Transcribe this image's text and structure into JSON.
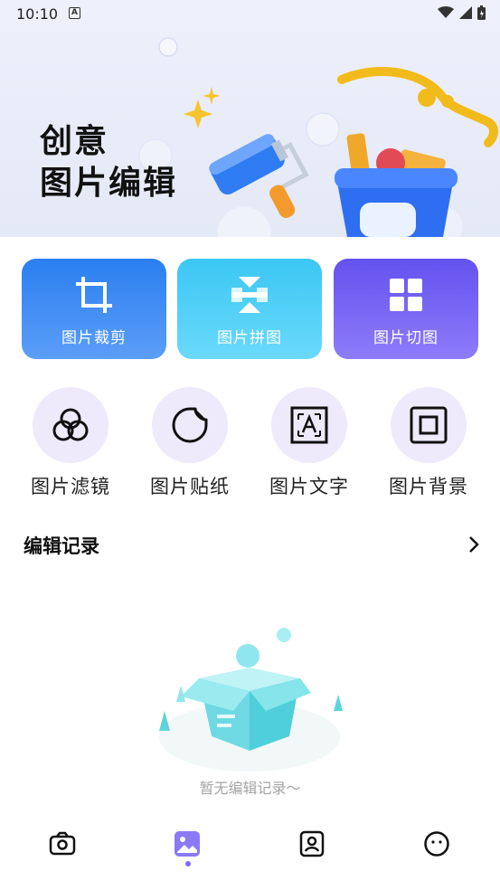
{
  "status_bar": {
    "time": "10:10",
    "notification_icon": "a-icon",
    "icons": [
      "wifi-icon",
      "cellular-icon",
      "battery-icon"
    ]
  },
  "hero": {
    "title_line1": "创意",
    "title_line2": "图片编辑"
  },
  "feature_tiles": [
    {
      "label": "图片裁剪",
      "icon": "crop-icon"
    },
    {
      "label": "图片拼图",
      "icon": "collage-icon"
    },
    {
      "label": "图片切图",
      "icon": "grid-icon"
    }
  ],
  "tools": [
    {
      "label": "图片滤镜",
      "icon": "filter-icon"
    },
    {
      "label": "图片贴纸",
      "icon": "sticker-icon"
    },
    {
      "label": "图片文字",
      "icon": "text-icon"
    },
    {
      "label": "图片背景",
      "icon": "background-icon"
    }
  ],
  "history": {
    "title": "编辑记录",
    "empty_message": "暂无编辑记录～"
  },
  "bottom_nav": {
    "items": [
      "camera-icon",
      "gallery-icon",
      "portrait-icon",
      "profile-icon"
    ],
    "active_index": 1,
    "accent_color": "#7b6cf2"
  },
  "colors": {
    "tile1": "#2a7ff0",
    "tile2": "#3bc7f3",
    "tile3": "#6452f0",
    "tool_circle": "#eeeafc"
  }
}
